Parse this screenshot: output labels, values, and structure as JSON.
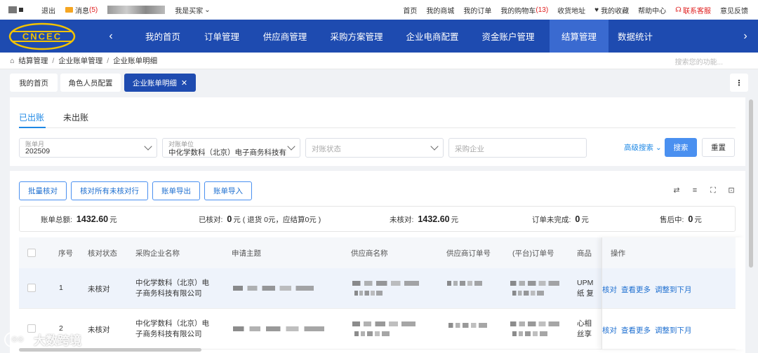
{
  "topbar": {
    "logout": "退出",
    "messages": "消息",
    "messages_count": "(5)",
    "buyer_role": "我是买家",
    "links": [
      "首页",
      "我的商城",
      "我的订单"
    ],
    "cart": "我的购物车",
    "cart_count": "(13)",
    "address": "收货地址",
    "favorites": "我的收藏",
    "help": "帮助中心",
    "support": "联系客服",
    "feedback": "意见反馈"
  },
  "logo_text": "CNCEC",
  "nav": {
    "items": [
      "我的首页",
      "订单管理",
      "供应商管理",
      "采购方案管理",
      "企业电商配置",
      "资金账户管理",
      "结算管理",
      "数据统计"
    ],
    "active_index": 6
  },
  "breadcrumb": [
    "结算管理",
    "企业账单管理",
    "企业账单明细"
  ],
  "search_function_placeholder": "搜索您的功能...",
  "tabs": [
    "我的首页",
    "角色人员配置",
    "企业账单明细"
  ],
  "subtabs": [
    "已出账",
    "未出账"
  ],
  "filters": {
    "bill_month_label": "账单月",
    "bill_month_value": "202509",
    "unit_label": "对账单位",
    "unit_value": "中化学数科（北京）电子商务科技有限公司",
    "status_placeholder": "对账状态",
    "buyer_placeholder": "采购企业",
    "advanced": "高级搜索",
    "search": "搜索",
    "reset": "重置"
  },
  "actions": [
    "批量核对",
    "核对所有未核对行",
    "账单导出",
    "账单导入"
  ],
  "summary": {
    "total_label": "账单总额:",
    "total_value": "1432.60",
    "total_unit": "元",
    "checked_label": "已核对:",
    "checked_value": "0",
    "checked_detail": "元 ( 退货 0元，应结算0元 )",
    "unchecked_label": "未核对:",
    "unchecked_value": "1432.60",
    "unchecked_unit": "元",
    "incomplete_label": "订单未完成:",
    "incomplete_value": "0",
    "incomplete_unit": "元",
    "aftersale_label": "售后中:",
    "aftersale_value": "0",
    "aftersale_unit": "元"
  },
  "table": {
    "headers": [
      "序号",
      "核对状态",
      "采购企业名称",
      "申请主题",
      "供应商名称",
      "供应商订单号",
      "(平台)订单号",
      "商品",
      "操作"
    ],
    "rows": [
      {
        "index": "1",
        "status": "未核对",
        "buyer": "中化学数科（北京）电子商务科技有限公司",
        "product": "UPM 纸 复",
        "ops": [
          "核对",
          "查看更多",
          "调整到下月"
        ]
      },
      {
        "index": "2",
        "status": "未核对",
        "buyer": "中化学数科（北京）电子商务科技有限公司",
        "product": "心相 丝享",
        "ops": [
          "核对",
          "查看更多",
          "调整到下月"
        ]
      }
    ]
  },
  "watermark": "大数跨境"
}
